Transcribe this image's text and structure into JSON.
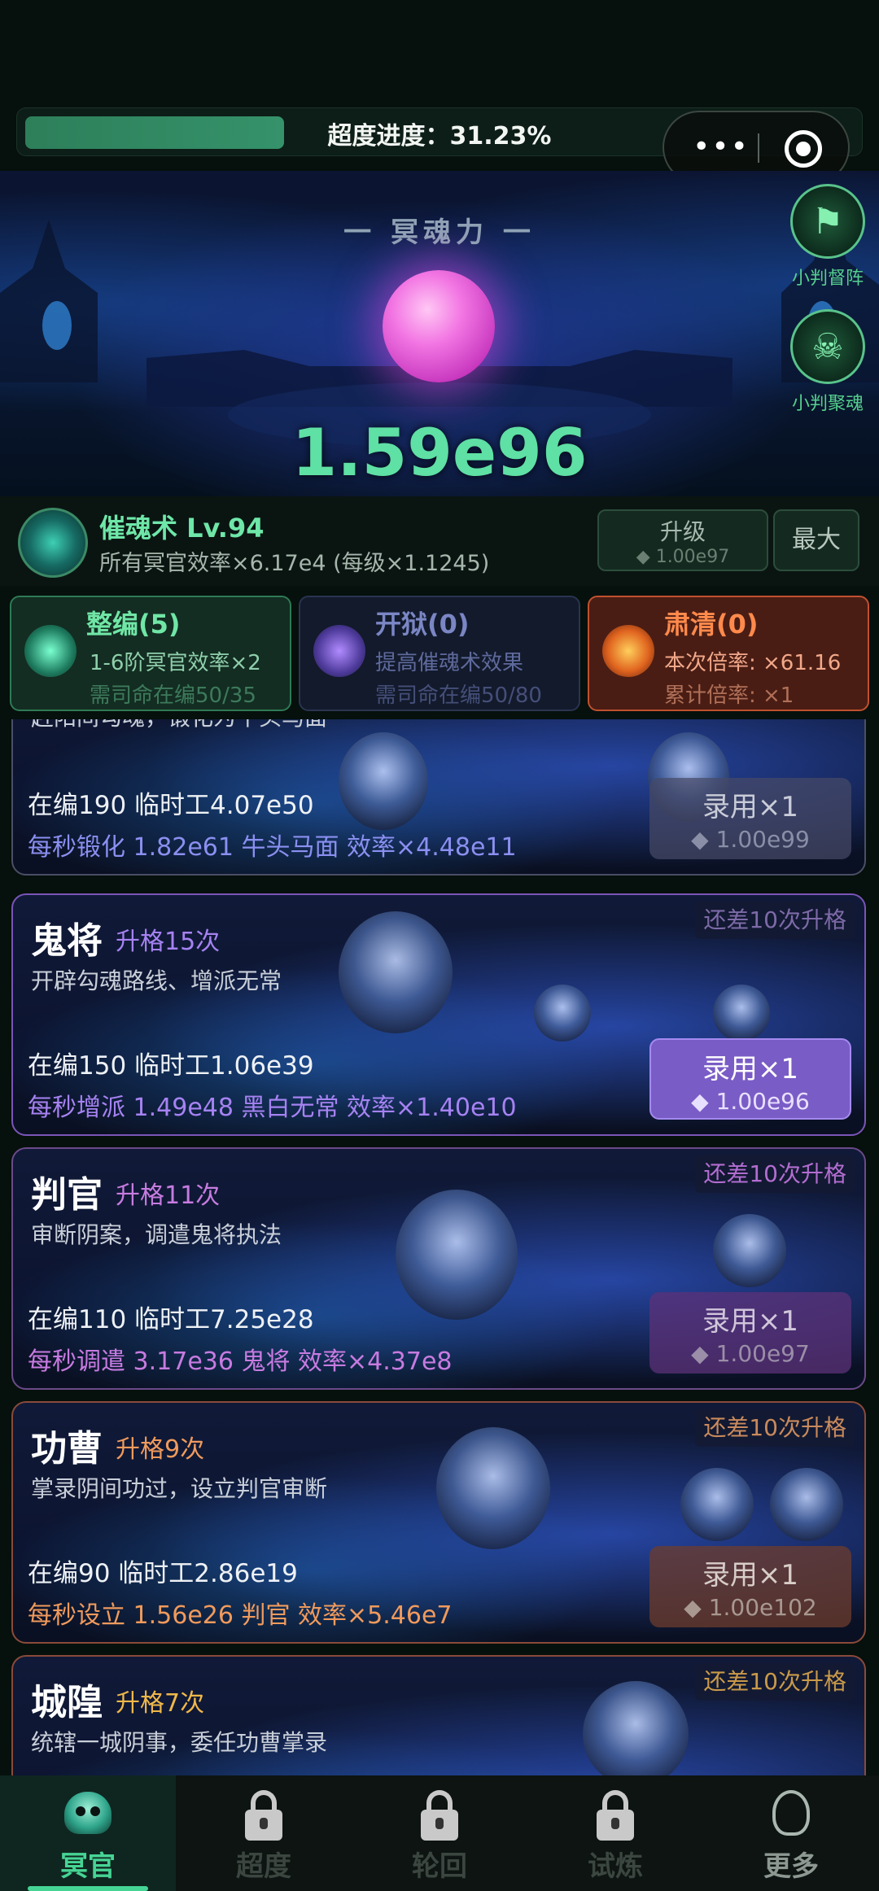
{
  "top": {
    "progress_label": "超度进度：31.23%",
    "progress_fraction": 0.3123,
    "capsule_more_icon": "more-dots-icon",
    "capsule_close_icon": "target-icon"
  },
  "hero": {
    "title": "一 冥魂力 一",
    "value": "1.59e96",
    "side_buttons": [
      {
        "label": "小判督阵",
        "icon": "flag-icon"
      },
      {
        "label": "小判聚魂",
        "icon": "ghost-icon"
      }
    ]
  },
  "skill": {
    "name": "催魂术 Lv.94",
    "desc": "所有冥官效率×6.17e4 (每级×1.1245)",
    "upgrade_label": "升级",
    "upgrade_cost": "◆ 1.00e97",
    "max_label": "最大"
  },
  "panels": [
    {
      "title": "整编(5)",
      "line1": "1-6阶冥官效率×2",
      "line2": "需司命在编50/35"
    },
    {
      "title": "开狱(0)",
      "line1": "提高催魂术效果",
      "line2": "需司命在编50/80"
    },
    {
      "title": "肃清(0)",
      "line1": "本次倍率: ×61.16",
      "line2": "累计倍率: ×1"
    }
  ],
  "cards": [
    {
      "name": "",
      "rank": "",
      "desc": "赶阳间勾魂，锻化为牛头马面",
      "badge": "",
      "staff": "在编190  临时工4.07e50",
      "rate": "每秒锻化 1.82e61 牛头马面  效率×4.48e11",
      "hire": "录用×1",
      "cost": "◆ 1.00e99",
      "rate_color": "#8b8ff0",
      "hire_style": "dim"
    },
    {
      "name": "鬼将",
      "rank": "升格15次",
      "desc": "开辟勾魂路线、增派无常",
      "badge": "还差10次升格",
      "staff": "在编150  临时工1.06e39",
      "rate": "每秒增派 1.49e48 黑白无常  效率×1.40e10",
      "hire": "录用×1",
      "cost": "◆ 1.00e96",
      "rate_color": "#a682f2",
      "rank_color": "#a682f2",
      "hire_style": "on"
    },
    {
      "name": "判官",
      "rank": "升格11次",
      "desc": "审断阴案，调遣鬼将执法",
      "badge": "还差10次升格",
      "staff": "在编110  临时工7.25e28",
      "rate": "每秒调遣 3.17e36 鬼将  效率×4.37e8",
      "hire": "录用×1",
      "cost": "◆ 1.00e97",
      "rate_color": "#c77be0",
      "rank_color": "#c77be0",
      "hire_style": "dim-p"
    },
    {
      "name": "功曹",
      "rank": "升格9次",
      "desc": "掌录阴间功过，设立判官审断",
      "badge": "还差10次升格",
      "staff": "在编90  临时工2.86e19",
      "rate": "每秒设立 1.56e26 判官  效率×5.46e7",
      "hire": "录用×1",
      "cost": "◆ 1.00e102",
      "rate_color": "#f09a5c",
      "rank_color": "#f09a5c",
      "hire_style": "dim-o"
    },
    {
      "name": "城隍",
      "rank": "升格7次",
      "desc": "统辖一城阴事，委任功曹掌录",
      "badge": "还差10次升格",
      "staff": "",
      "rate": "",
      "hire": "",
      "cost": "",
      "rate_color": "#f0b84a",
      "rank_color": "#f0b84a",
      "hire_style": "dim-o"
    }
  ],
  "nav": [
    {
      "label": "冥官",
      "state": "active",
      "icon": "skull-icon"
    },
    {
      "label": "超度",
      "state": "locked",
      "icon": "lock-icon"
    },
    {
      "label": "轮回",
      "state": "locked",
      "icon": "lock-icon"
    },
    {
      "label": "试炼",
      "state": "locked",
      "icon": "lock-icon"
    },
    {
      "label": "更多",
      "state": "more",
      "icon": "more-icon"
    }
  ]
}
